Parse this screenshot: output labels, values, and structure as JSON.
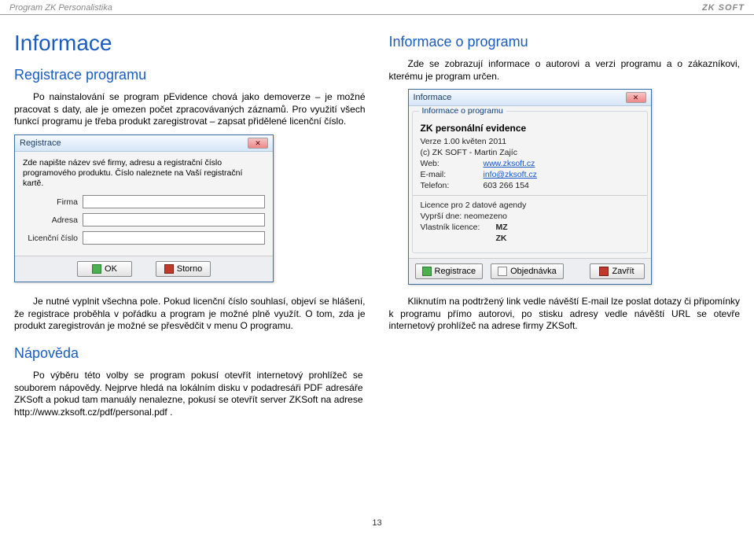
{
  "header": {
    "left": "Program ZK Personalistika",
    "right": "ZK SOFT"
  },
  "left": {
    "h1": "Informace",
    "h2": "Registrace programu",
    "para": "Po nainstalování se program pEvidence chová jako demoverze – je možné pracovat s daty, ale je omezen počet zpracovávaných záznamů. Pro využití všech funkcí programu je třeba produkt zaregistrovat – zapsat přidělené licenční číslo."
  },
  "right": {
    "h2": "Informace o programu",
    "para": "Zde se zobrazují informace o autorovi a verzi programu a o zákazníkovi, kterému je program určen."
  },
  "regDialog": {
    "title": "Registrace",
    "hint": "Zde napište název své firmy, adresu a registrační číslo programového produktu. Číslo naleznete na Vaší registrační kartě.",
    "labels": {
      "firma": "Firma",
      "adresa": "Adresa",
      "lic": "Licenční číslo"
    },
    "ok": "OK",
    "storno": "Storno"
  },
  "infoDialog": {
    "title": "Informace",
    "group": "Informace o programu",
    "product": "ZK personální evidence",
    "verze": "Verze 1.00   květen 2011",
    "copyright": "(c)  ZK SOFT - Martin Zajíc",
    "rows": {
      "web_k": "Web:",
      "web_v": "www.zksoft.cz",
      "mail_k": "E-mail:",
      "mail_v": "info@zksoft.cz",
      "tel_k": "Telefon:",
      "tel_v": "603 266 154"
    },
    "lic1": "Licence pro  2  datové agendy",
    "lic2": "Vyprší dne: neomezeno",
    "lic3_k": "Vlastník licence:",
    "lic3_v": "MZ",
    "lic4": "ZK",
    "btnReg": "Registrace",
    "btnObj": "Objednávka",
    "btnClose": "Zavřít"
  },
  "mid": {
    "left": "Je nutné vyplnit všechna pole. Pokud licenční číslo souhlasí, objeví se hlášení, že registrace proběhla v pořádku a program je možné plně využít. O tom, zda je produkt zaregistrován je možné se přesvědčit v menu O programu.",
    "right": "Kliknutím na podtržený link vedle návěští E-mail lze poslat dotazy či připomínky k programu přímo autorovi, po stisku adresy vedle návěští URL se otevře internetový prohlížeč na adrese firmy ZKSoft."
  },
  "napoveda": {
    "h2": "Nápověda",
    "para": "Po výběru této volby se program pokusí otevřít internetový prohlížeč se souborem nápovědy. Nejprve hledá na lokálním disku v podadresáři PDF adresáře ZKSoft a pokud tam manuály nenalezne, pokusí se otevřít server ZKSoft na adrese http://www.zksoft.cz/pdf/personal.pdf ."
  },
  "page": "13"
}
